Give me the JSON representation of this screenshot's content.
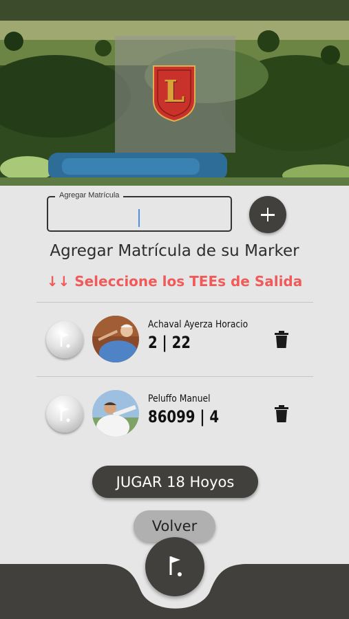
{
  "license_input": {
    "label": "Agregar Matrícula",
    "value": ""
  },
  "heading": "Agregar Matrícula de su Marker",
  "tees_instruction": "↓↓ Seleccione los TEEs de Salida",
  "players": [
    {
      "name": "Achaval Ayerza Horacio",
      "numbers": "2 | 22"
    },
    {
      "name": "Peluffo Manuel",
      "numbers": "86099 | 4"
    }
  ],
  "actions": {
    "play_label": "JUGAR 18 Hoyos",
    "back_label": "Volver"
  },
  "logo": {
    "letter": "L"
  },
  "colors": {
    "primary_dark": "#42403c",
    "warning_red": "#f05a5a",
    "background": "#e6e6e6"
  }
}
